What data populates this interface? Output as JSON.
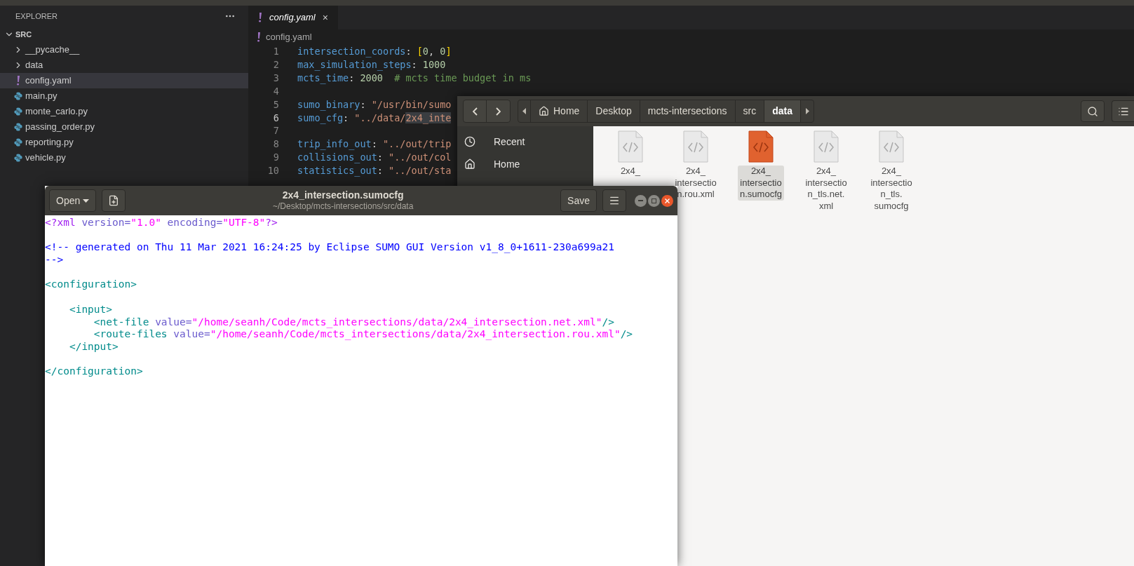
{
  "vscode": {
    "explorer": {
      "title": "EXPLORER",
      "root": {
        "name": "SRC",
        "expanded": true,
        "children": [
          {
            "name": "__pycache__",
            "kind": "folder",
            "expanded": false,
            "selected": false
          },
          {
            "name": "data",
            "kind": "folder",
            "expanded": false,
            "selected": false
          },
          {
            "name": "config.yaml",
            "kind": "yaml",
            "selected": true
          },
          {
            "name": "main.py",
            "kind": "python",
            "selected": false
          },
          {
            "name": "monte_carlo.py",
            "kind": "python",
            "selected": false
          },
          {
            "name": "passing_order.py",
            "kind": "python",
            "selected": false
          },
          {
            "name": "reporting.py",
            "kind": "python",
            "selected": false
          },
          {
            "name": "vehicle.py",
            "kind": "python",
            "selected": false
          }
        ]
      }
    },
    "tabs": [
      {
        "label": "config.yaml",
        "selected": true,
        "close": "×"
      }
    ],
    "breadcrumb": "config.yaml",
    "lines": [
      {
        "number": "1",
        "current": false,
        "tokens": [
          {
            "kind": "key",
            "text": "intersection_coords"
          },
          {
            "kind": "punct",
            "text": ": "
          },
          {
            "kind": "bracket",
            "text": "["
          },
          {
            "kind": "number",
            "text": "0"
          },
          {
            "kind": "punct",
            "text": ", "
          },
          {
            "kind": "number",
            "text": "0"
          },
          {
            "kind": "bracket",
            "text": "]"
          }
        ]
      },
      {
        "number": "2",
        "current": false,
        "tokens": [
          {
            "kind": "key",
            "text": "max_simulation_steps"
          },
          {
            "kind": "punct",
            "text": ": "
          },
          {
            "kind": "number",
            "text": "1000"
          }
        ]
      },
      {
        "number": "3",
        "current": false,
        "tokens": [
          {
            "kind": "key",
            "text": "mcts_time"
          },
          {
            "kind": "punct",
            "text": ": "
          },
          {
            "kind": "number",
            "text": "2000"
          },
          {
            "kind": "comment",
            "text": "  # mcts time budget in ms"
          }
        ]
      },
      {
        "number": "4",
        "current": false
      },
      {
        "number": "5",
        "current": false,
        "tokens": [
          {
            "kind": "key",
            "text": "sumo_binary"
          },
          {
            "kind": "punct",
            "text": ": "
          },
          {
            "kind": "string",
            "text": "\"/usr/bin/sumo"
          }
        ]
      },
      {
        "number": "6",
        "current": true,
        "tokens": [
          {
            "kind": "key",
            "text": "sumo_cfg"
          },
          {
            "kind": "punct",
            "text": ": "
          },
          {
            "kind": "string",
            "text": "\"../data/"
          },
          {
            "kind": "highlight",
            "text": "2x4_inte"
          }
        ]
      },
      {
        "number": "7",
        "current": false
      },
      {
        "number": "8",
        "current": false,
        "tokens": [
          {
            "kind": "key",
            "text": "trip_info_out"
          },
          {
            "kind": "punct",
            "text": ": "
          },
          {
            "kind": "string",
            "text": "\"../out/trip"
          }
        ]
      },
      {
        "number": "9",
        "current": false,
        "tokens": [
          {
            "kind": "key",
            "text": "collisions_out"
          },
          {
            "kind": "punct",
            "text": ": "
          },
          {
            "kind": "string",
            "text": "\"../out/col"
          }
        ]
      },
      {
        "number": "10",
        "current": false,
        "tokens": [
          {
            "kind": "key",
            "text": "statistics_out"
          },
          {
            "kind": "punct",
            "text": ": "
          },
          {
            "kind": "string",
            "text": "\"../out/sta"
          }
        ]
      }
    ]
  },
  "files": {
    "path": [
      {
        "label": "Home",
        "kind": "home",
        "selected": false
      },
      {
        "label": "Desktop",
        "kind": "folder",
        "selected": false
      },
      {
        "label": "mcts-intersections",
        "kind": "folder",
        "selected": false
      },
      {
        "label": "src",
        "kind": "folder",
        "selected": false
      },
      {
        "label": "data",
        "kind": "folder",
        "selected": true
      }
    ],
    "places": [
      {
        "label": "Recent",
        "kind": "recent"
      },
      {
        "label": "Home",
        "kind": "home"
      }
    ],
    "items": [
      {
        "label_lines": [
          "2x4_"
        ],
        "selected": false
      },
      {
        "label_lines": [
          "2x4_",
          "intersectio",
          "n.rou.xml"
        ],
        "selected": false
      },
      {
        "label_lines": [
          "2x4_",
          "intersectio",
          "n.sumocfg"
        ],
        "selected": true
      },
      {
        "label_lines": [
          "2x4_",
          "intersectio",
          "n_tls.net.",
          "xml"
        ],
        "selected": false
      },
      {
        "label_lines": [
          "2x4_",
          "intersectio",
          "n_tls.",
          "sumocfg"
        ],
        "selected": false
      }
    ]
  },
  "gedit": {
    "open_label": "Open",
    "title": "2x4_intersection.sumocfg",
    "subtitle": "~/Desktop/mcts-intersections/src/data",
    "save_label": "Save",
    "blocks": [
      {
        "lines": [
          {
            "tokens": [
              {
                "kind": "pi",
                "text": "<?xml"
              },
              {
                "kind": "attr",
                "text": " version="
              },
              {
                "kind": "string",
                "text": "\"1.0\""
              },
              {
                "kind": "attr",
                "text": " encoding="
              },
              {
                "kind": "string",
                "text": "\"UTF-8\""
              },
              {
                "kind": "pi",
                "text": "?>"
              }
            ]
          }
        ]
      },
      {
        "lines": [
          {
            "tokens": [
              {
                "kind": "comment",
                "text": "<!-- generated on Thu 11 Mar 2021 16:24:25 by Eclipse SUMO GUI Version v1_8_0+1611-230a699a21"
              }
            ]
          },
          {
            "tokens": [
              {
                "kind": "comment",
                "text": "-->"
              }
            ]
          }
        ]
      },
      {
        "lines": [
          {
            "tokens": [
              {
                "kind": "tag",
                "text": "<configuration>"
              }
            ]
          }
        ]
      },
      {
        "lines": [
          {
            "tokens": [
              {
                "kind": "tag",
                "text": "    <input>"
              }
            ]
          },
          {
            "tokens": [
              {
                "kind": "tag",
                "text": "        <net-file"
              },
              {
                "kind": "attr",
                "text": " value="
              },
              {
                "kind": "string",
                "text": "\"/home/seanh/Code/mcts_intersections/data/2x4_intersection.net.xml\""
              },
              {
                "kind": "tag",
                "text": "/>"
              }
            ]
          },
          {
            "tokens": [
              {
                "kind": "tag",
                "text": "        <route-files"
              },
              {
                "kind": "attr",
                "text": " value="
              },
              {
                "kind": "string",
                "text": "\"/home/seanh/Code/mcts_intersections/data/2x4_intersection.rou.xml\""
              },
              {
                "kind": "tag",
                "text": "/>"
              }
            ]
          },
          {
            "tokens": [
              {
                "kind": "tag",
                "text": "    </input>"
              }
            ]
          }
        ]
      },
      {
        "lines": [
          {
            "tokens": [
              {
                "kind": "tag",
                "text": "</configuration>"
              }
            ]
          }
        ]
      }
    ]
  }
}
